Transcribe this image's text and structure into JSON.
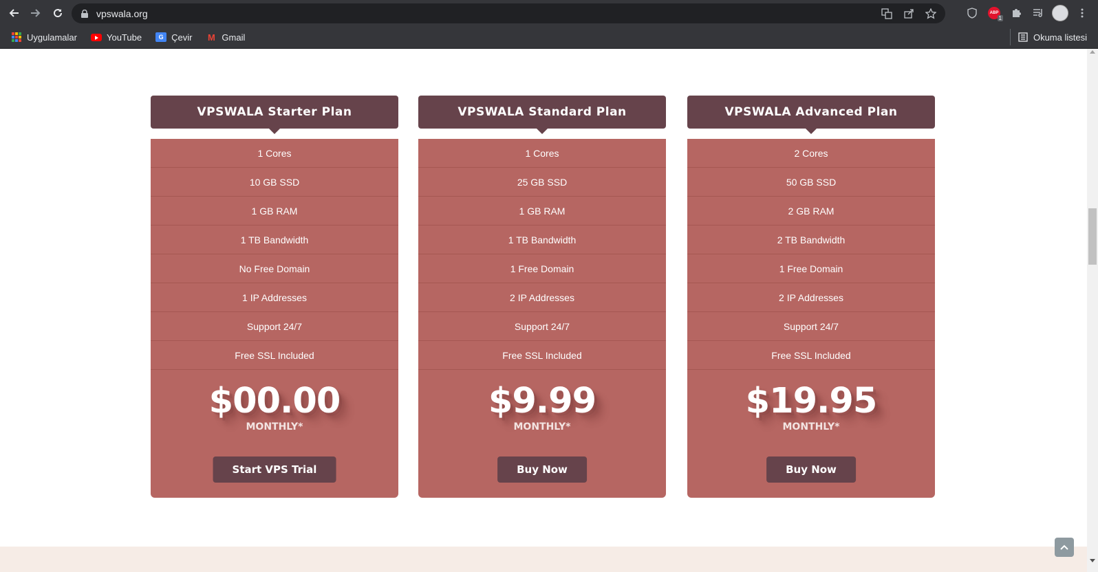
{
  "browser": {
    "url": "vpswala.org",
    "bookmarks": [
      {
        "label": "Uygulamalar",
        "icon": "apps-grid-icon"
      },
      {
        "label": "YouTube",
        "icon": "youtube-icon"
      },
      {
        "label": "Çevir",
        "icon": "translate-icon"
      },
      {
        "label": "Gmail",
        "icon": "gmail-icon"
      }
    ],
    "reading_list": "Okuma listesi",
    "adblock_count": "1"
  },
  "plans": [
    {
      "title": "VPSWALA Starter Plan",
      "features": [
        "1 Cores",
        "10 GB SSD",
        "1 GB RAM",
        "1 TB Bandwidth",
        "No Free Domain",
        "1 IP Addresses",
        "Support 24/7",
        "Free SSL Included"
      ],
      "price": "$00.00",
      "period": "MONTHLY*",
      "button": "Start VPS Trial"
    },
    {
      "title": "VPSWALA Standard Plan",
      "features": [
        "1 Cores",
        "25 GB SSD",
        "1 GB RAM",
        "1 TB Bandwidth",
        "1 Free Domain",
        "2 IP Addresses",
        "Support 24/7",
        "Free SSL Included"
      ],
      "price": "$9.99",
      "period": "MONTHLY*",
      "button": "Buy Now"
    },
    {
      "title": "VPSWALA Advanced Plan",
      "features": [
        "2 Cores",
        "50 GB SSD",
        "2 GB RAM",
        "2 TB Bandwidth",
        "1 Free Domain",
        "2 IP Addresses",
        "Support 24/7",
        "Free SSL Included"
      ],
      "price": "$19.95",
      "period": "MONTHLY*",
      "button": "Buy Now"
    }
  ],
  "colors": {
    "header": "#66434b",
    "card": "#b66662",
    "button": "#66434b"
  }
}
